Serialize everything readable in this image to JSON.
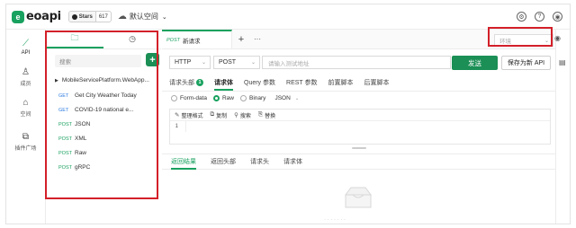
{
  "app": {
    "logo_mark": "e",
    "logo_text": "eoapi",
    "github_label": "Stars",
    "github_count": "617",
    "workspace_icon": "cloud-icon",
    "workspace_label": "默认空间"
  },
  "topbar_icons": [
    "settings-icon",
    "help-icon",
    "user-icon"
  ],
  "left_nav": [
    {
      "label": "API",
      "icon": "api-icon",
      "active": true
    },
    {
      "label": "成员",
      "icon": "members-icon",
      "active": false
    },
    {
      "label": "空间",
      "icon": "workspace-icon",
      "active": false
    },
    {
      "label": "插件广场",
      "icon": "plugin-icon",
      "active": false
    }
  ],
  "sidebar": {
    "tabs": [
      {
        "icon": "folder-icon",
        "active": true
      },
      {
        "icon": "history-icon",
        "active": false
      }
    ],
    "search_placeholder": "搜索",
    "add_label": "+",
    "root_label": "MobileServicePlatform.WebApp...",
    "apis": [
      {
        "method": "GET",
        "name": "Get City Weather Today"
      },
      {
        "method": "GET",
        "name": "COVID-19 national e..."
      },
      {
        "method": "POST",
        "name": "JSON"
      },
      {
        "method": "POST",
        "name": "XML"
      },
      {
        "method": "POST",
        "name": "Raw"
      },
      {
        "method": "POST",
        "name": "gRPC"
      }
    ]
  },
  "tabs": {
    "current": {
      "method": "POST",
      "title": "新请求"
    },
    "add_label": "+",
    "more_label": "···"
  },
  "environment": {
    "placeholder": "环境"
  },
  "request": {
    "protocol": "HTTP",
    "method": "POST",
    "url_placeholder": "请输入测试地址",
    "send_label": "发送",
    "save_label": "保存为新 API"
  },
  "request_tabs": [
    {
      "label": "请求头部",
      "badge": "1",
      "active": false
    },
    {
      "label": "请求体",
      "active": true
    },
    {
      "label": "Query 参数",
      "active": false
    },
    {
      "label": "REST 参数",
      "active": false
    },
    {
      "label": "前置脚本",
      "active": false
    },
    {
      "label": "后置脚本",
      "active": false
    }
  ],
  "body_types": [
    {
      "label": "Form-data",
      "checked": false
    },
    {
      "label": "Raw",
      "checked": true
    },
    {
      "label": "Binary",
      "checked": false
    }
  ],
  "raw_format": "JSON",
  "editor_tools": [
    {
      "icon": "format-icon",
      "label": "整理格式"
    },
    {
      "icon": "copy-icon",
      "label": "复制"
    },
    {
      "icon": "search-icon",
      "label": "搜索"
    },
    {
      "icon": "replace-icon",
      "label": "替换"
    }
  ],
  "editor_line": "1",
  "response_tabs": [
    {
      "label": "返回结果",
      "active": true
    },
    {
      "label": "返回头部",
      "active": false
    },
    {
      "label": "请求头",
      "active": false
    },
    {
      "label": "请求体",
      "active": false
    }
  ],
  "empty_text": "· · · · · · ·"
}
